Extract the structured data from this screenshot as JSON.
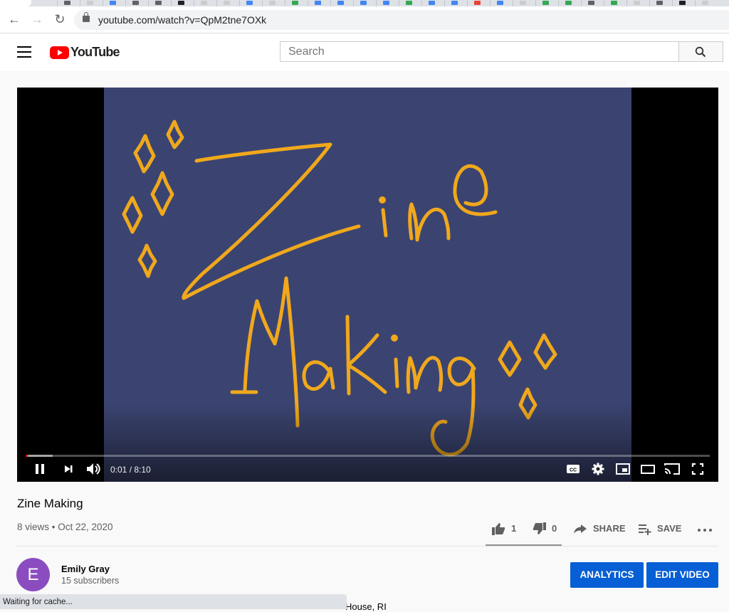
{
  "browser": {
    "url": "youtube.com/watch?v=QpM2tne7OXk"
  },
  "header": {
    "logo_text": "YouTube",
    "search_placeholder": "Search"
  },
  "player": {
    "artwork_lettering": "Zine Making",
    "time_display": "0:01 / 8:10",
    "played_fraction": 0.002,
    "buffered_fraction": 0.04,
    "artwork_colors": {
      "background": "#3b4470",
      "lettering": "#f0a81c"
    },
    "controls": [
      "pause-icon",
      "next-icon",
      "volume-icon",
      "captions-icon",
      "settings-icon",
      "miniplayer-icon",
      "theater-icon",
      "cast-icon",
      "fullscreen-icon"
    ]
  },
  "video": {
    "title": "Zine Making",
    "meta": "8 views • Oct 22, 2020",
    "likes": "1",
    "dislikes": "0",
    "share_label": "SHARE",
    "save_label": "SAVE"
  },
  "channel": {
    "avatar_letter": "E",
    "name": "Emily Gray",
    "subscribers": "15 subscribers",
    "analytics_label": "ANALYTICS",
    "edit_label": "EDIT VIDEO",
    "avatar_color": "#8a4cbf",
    "button_color": "#065fd4"
  },
  "description_fragment": "House, RI",
  "status_bar": "Waiting for cache..."
}
